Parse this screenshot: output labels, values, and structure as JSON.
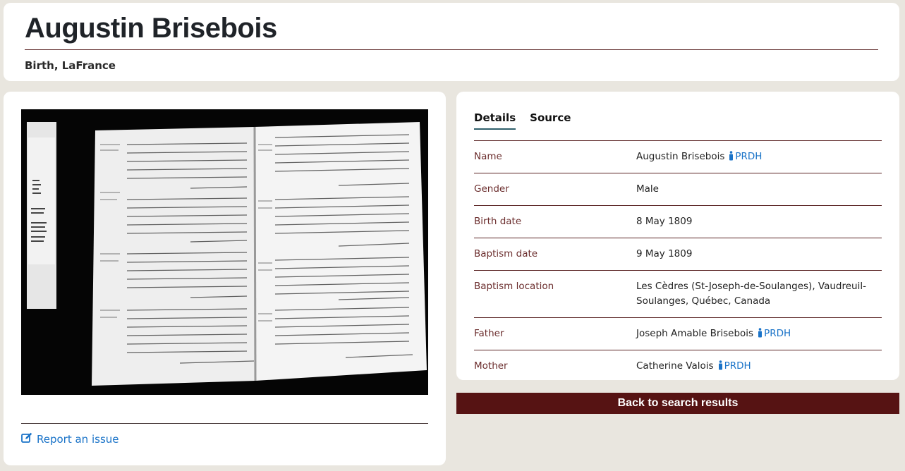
{
  "header": {
    "title": "Augustin Brisebois",
    "subtitle": "Birth, LaFrance"
  },
  "image_panel": {
    "report_link": "Report an issue",
    "scan_icon": "register-scan-image"
  },
  "tabs": [
    {
      "label": "Details",
      "active": true
    },
    {
      "label": "Source",
      "active": false
    }
  ],
  "details": [
    {
      "key": "Name",
      "value": "Augustin Brisebois",
      "link": "PRDH"
    },
    {
      "key": "Gender",
      "value": "Male",
      "link": ""
    },
    {
      "key": "Birth date",
      "value": "8 May 1809",
      "link": ""
    },
    {
      "key": "Baptism date",
      "value": "9 May 1809",
      "link": ""
    },
    {
      "key": "Baptism location",
      "value": "Les Cèdres (St-Joseph-de-Soulanges), Vaudreuil-Soulanges, Québec, Canada",
      "link": ""
    },
    {
      "key": "Father",
      "value": "Joseph Amable Brisebois",
      "link": "PRDH"
    },
    {
      "key": "Mother",
      "value": "Catherine Valois",
      "link": "PRDH"
    }
  ],
  "back_button": "Back to search results",
  "colors": {
    "background": "#e9e6df",
    "accent": "#561313",
    "link": "#1a73c8",
    "label": "#6b2d2d"
  }
}
